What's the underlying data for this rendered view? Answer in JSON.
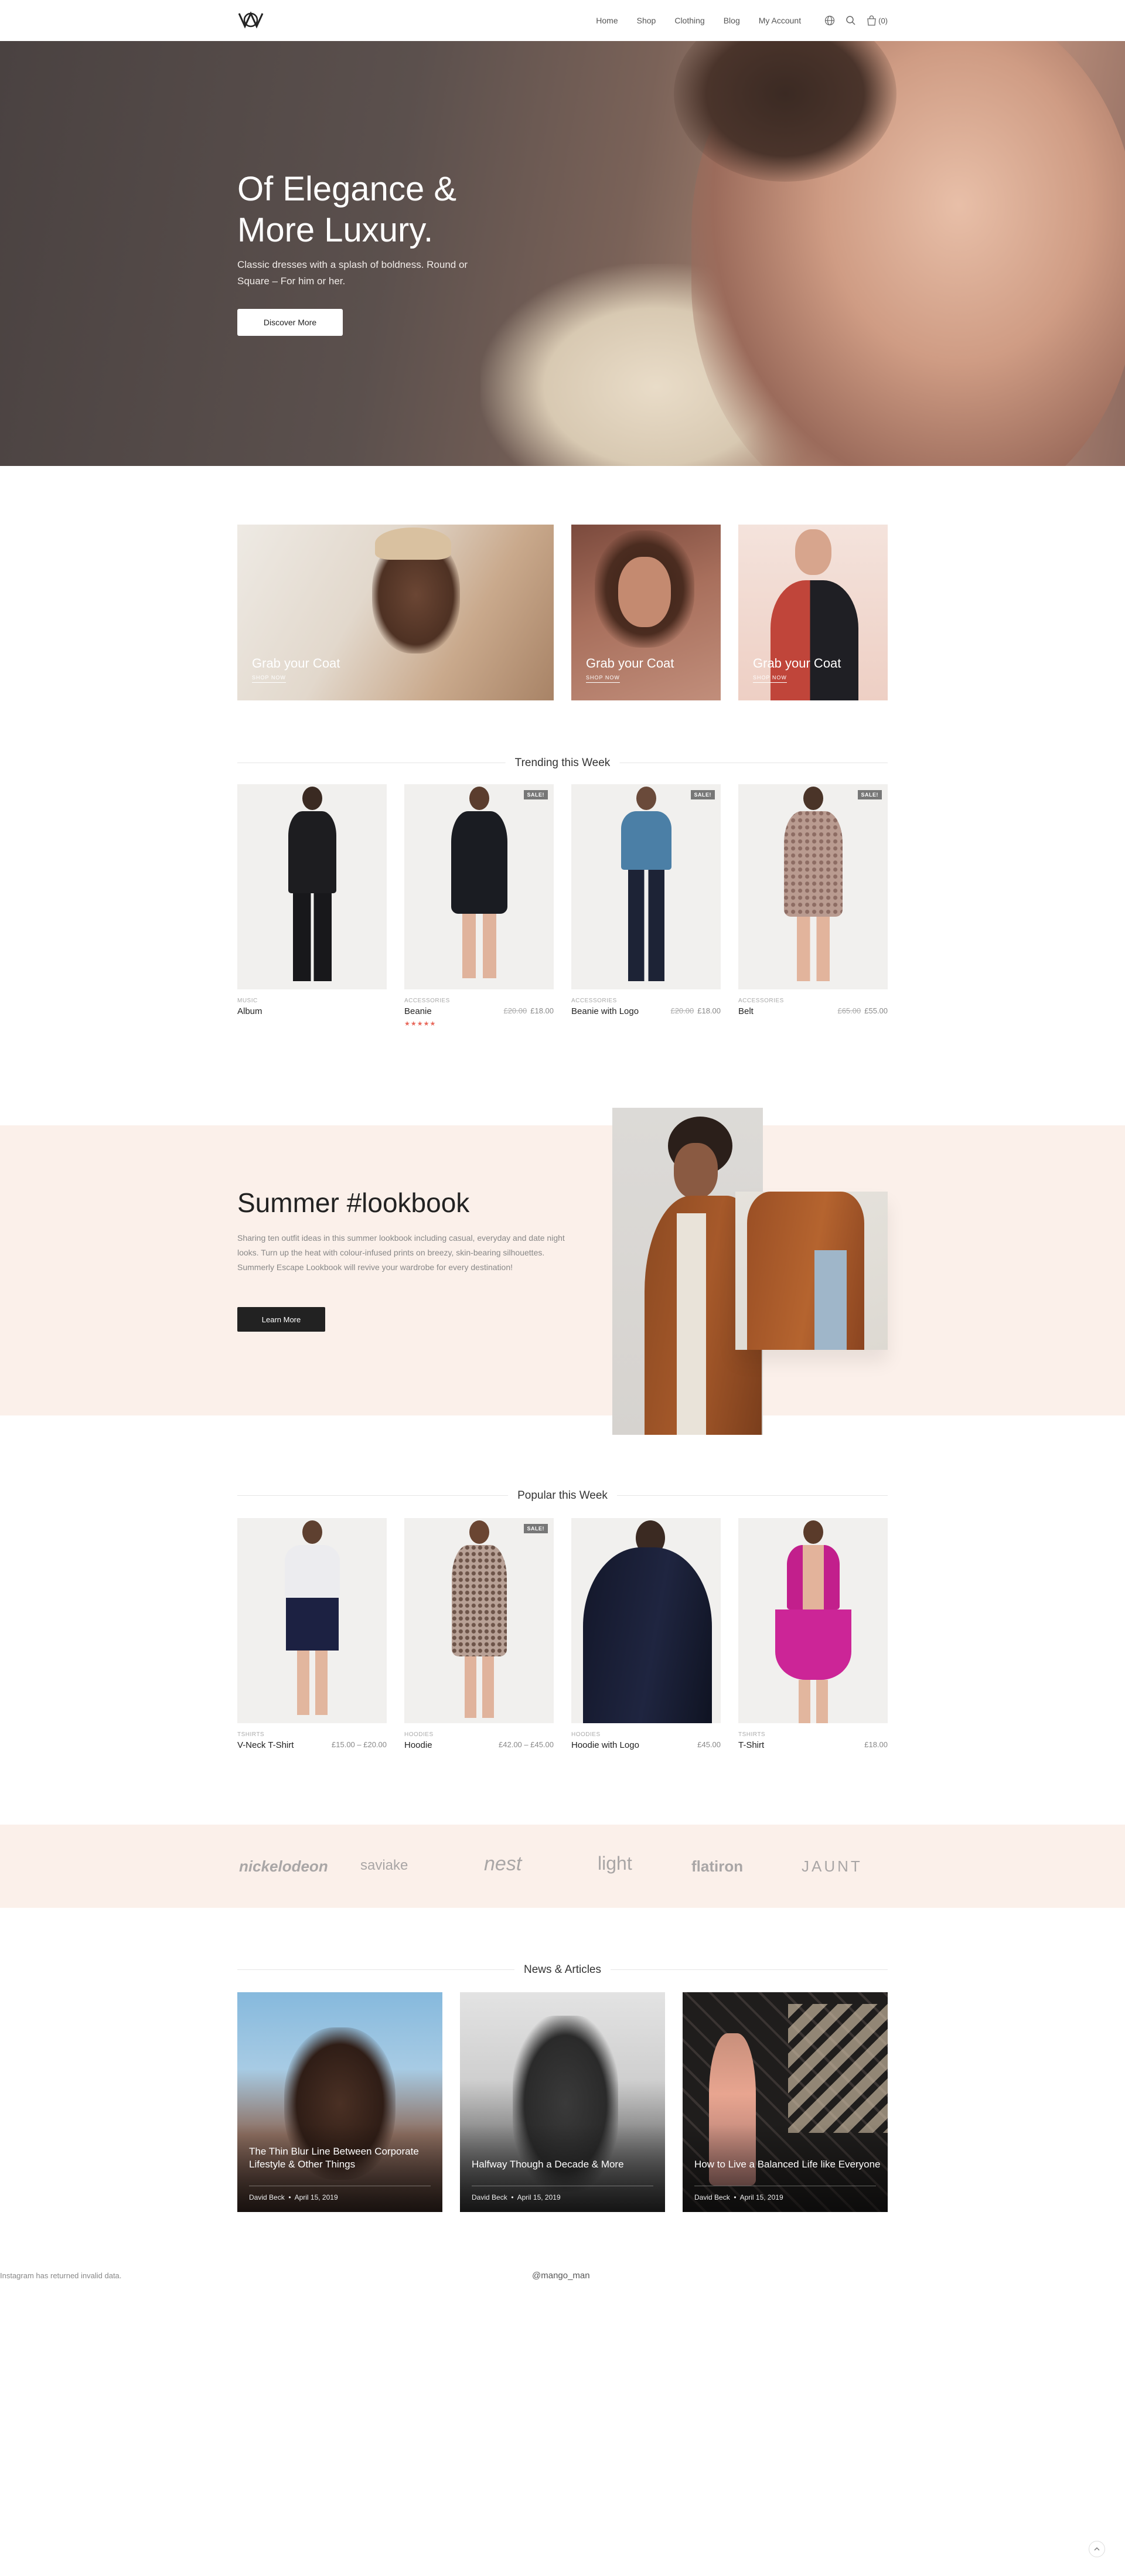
{
  "header": {
    "nav": [
      "Home",
      "Shop",
      "Clothing",
      "Blog",
      "My Account"
    ],
    "cart_count": "(0)"
  },
  "hero": {
    "title": "Of Elegance & More Luxury.",
    "subtitle": "Classic dresses with a splash of boldness. Round or Square – For him or her.",
    "button": "Discover More"
  },
  "promos": [
    {
      "caption": "Grab your Coat",
      "link": "SHOP NOW"
    },
    {
      "caption": "Grab your Coat",
      "link": "SHOP NOW"
    },
    {
      "caption": "Grab your Coat",
      "link": "SHOP NOW"
    }
  ],
  "trending": {
    "title": "Trending this Week",
    "products": [
      {
        "category": "MUSIC",
        "name": "Album",
        "old_price": "",
        "price": "",
        "sale": "",
        "rating": ""
      },
      {
        "category": "ACCESSORIES",
        "name": "Beanie",
        "old_price": "£20.00",
        "price": "£18.00",
        "sale": "SALE!",
        "rating": "★★★★★"
      },
      {
        "category": "ACCESSORIES",
        "name": "Beanie with Logo",
        "old_price": "£20.00",
        "price": "£18.00",
        "sale": "SALE!",
        "rating": ""
      },
      {
        "category": "ACCESSORIES",
        "name": "Belt",
        "old_price": "£65.00",
        "price": "£55.00",
        "sale": "SALE!",
        "rating": ""
      }
    ]
  },
  "lookbook": {
    "title": "Summer #lookbook",
    "text": "Sharing ten outfit ideas in this summer lookbook including casual, everyday and date night looks. Turn up the heat with colour-infused prints on breezy, skin-bearing silhouettes. Summerly Escape Lookbook will revive your wardrobe for every destination!",
    "button": "Learn More"
  },
  "popular": {
    "title": "Popular this Week",
    "products": [
      {
        "category": "TSHIRTS",
        "name": "V-Neck T-Shirt",
        "old_price": "",
        "price": "£15.00 – £20.00",
        "sale": ""
      },
      {
        "category": "HOODIES",
        "name": "Hoodie",
        "old_price": "",
        "price": "£42.00 – £45.00",
        "sale": "SALE!"
      },
      {
        "category": "HOODIES",
        "name": "Hoodie with Logo",
        "old_price": "",
        "price": "£45.00",
        "sale": ""
      },
      {
        "category": "TSHIRTS",
        "name": "T-Shirt",
        "old_price": "",
        "price": "£18.00",
        "sale": ""
      }
    ]
  },
  "brands": [
    "nickelodeon",
    "saviake",
    "nest",
    "light",
    "flatiron",
    "JAUNT"
  ],
  "news": {
    "title": "News & Articles",
    "articles": [
      {
        "title": "The Thin Blur Line Between Corporate Lifestyle & Other Things",
        "author": "David Beck",
        "date": "April 15, 2019"
      },
      {
        "title": "Halfway Though a Decade & More",
        "author": "David Beck",
        "date": "April 15, 2019"
      },
      {
        "title": "How to Live a Balanced Life like Everyone",
        "author": "David Beck",
        "date": "April 15, 2019"
      }
    ]
  },
  "instagram": {
    "error": "Instagram has returned invalid data.",
    "username": "@mango_man"
  }
}
